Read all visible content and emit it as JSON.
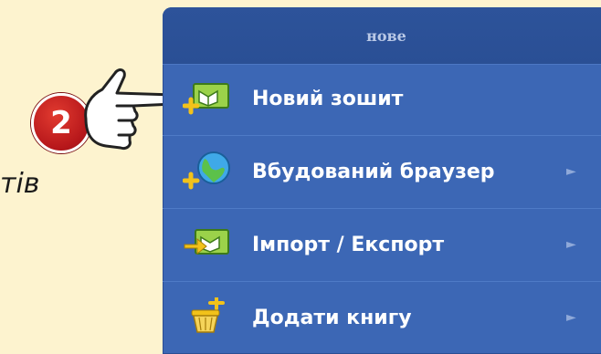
{
  "background": {
    "partial_text": "тів"
  },
  "step_badge": {
    "number": "2"
  },
  "menu": {
    "header": "нове",
    "items": [
      {
        "label": "Новий зошит",
        "icon": "new-notebook-icon",
        "has_submenu": false
      },
      {
        "label": "Вбудований браузер",
        "icon": "globe-icon",
        "has_submenu": true
      },
      {
        "label": "Імпорт / Експорт",
        "icon": "import-export-icon",
        "has_submenu": true
      },
      {
        "label": "Додати книгу",
        "icon": "add-book-basket-icon",
        "has_submenu": true
      }
    ],
    "submenu_arrow": "►"
  },
  "colors": {
    "menu_bg": "#3c67b5",
    "header_bg": "#2d539a",
    "badge_red": "#c0181c",
    "page_bg": "#fdf3cf"
  }
}
